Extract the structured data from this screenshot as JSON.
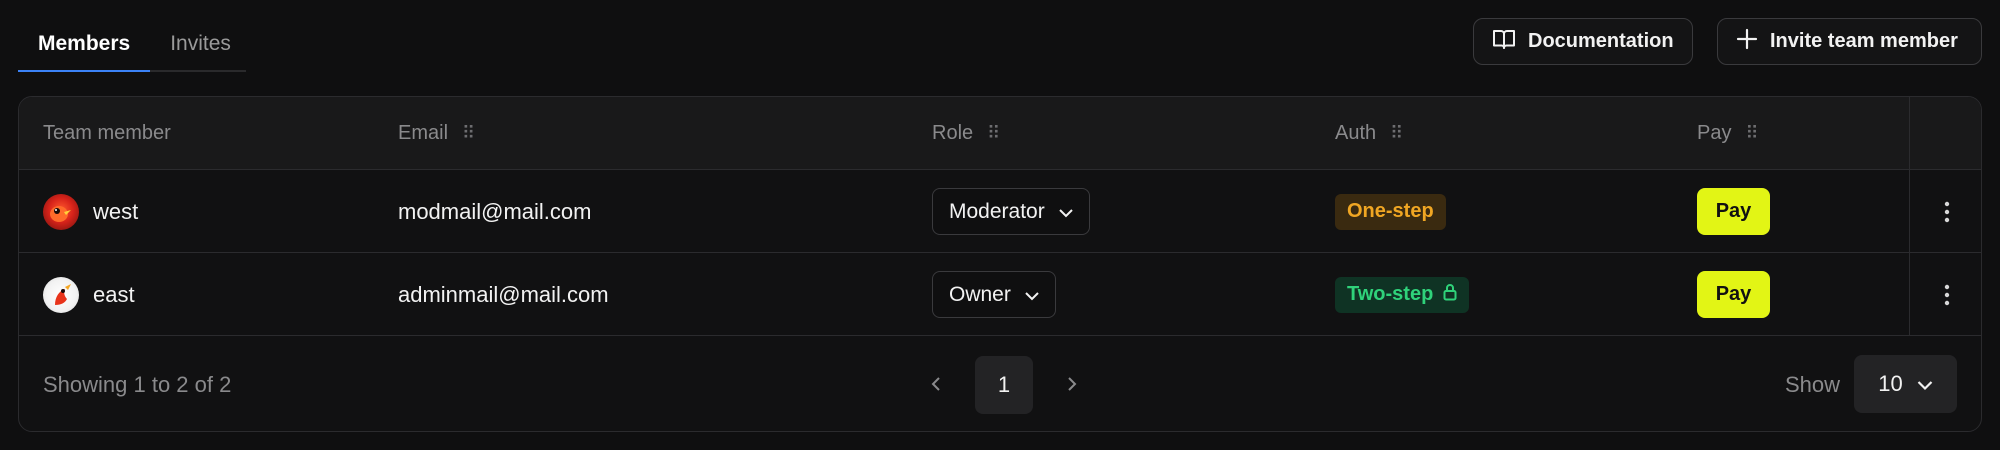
{
  "tabs": [
    {
      "label": "Members",
      "active": true
    },
    {
      "label": "Invites",
      "active": false
    }
  ],
  "toolbar": {
    "documentation_label": "Documentation",
    "invite_label": "Invite team member"
  },
  "table": {
    "headers": {
      "member": "Team member",
      "email": "Email",
      "role": "Role",
      "auth": "Auth",
      "pay": "Pay"
    },
    "rows": [
      {
        "name": "west",
        "email": "modmail@mail.com",
        "role": "Moderator",
        "auth": "One-step",
        "auth_locked": false,
        "pay": "Pay",
        "avatar": "red-bird-avatar"
      },
      {
        "name": "east",
        "email": "adminmail@mail.com",
        "role": "Owner",
        "auth": "Two-step",
        "auth_locked": true,
        "pay": "Pay",
        "avatar": "white-bird-avatar"
      }
    ]
  },
  "footer": {
    "showing": "Showing 1 to 2 of 2",
    "current_page": "1",
    "show_label": "Show",
    "page_size": "10"
  },
  "colors": {
    "background": "#0f0f10",
    "accent": "#3b82f6",
    "pay_button": "#e2f515",
    "one_step": "#f0a623",
    "two_step": "#2fd27a"
  }
}
